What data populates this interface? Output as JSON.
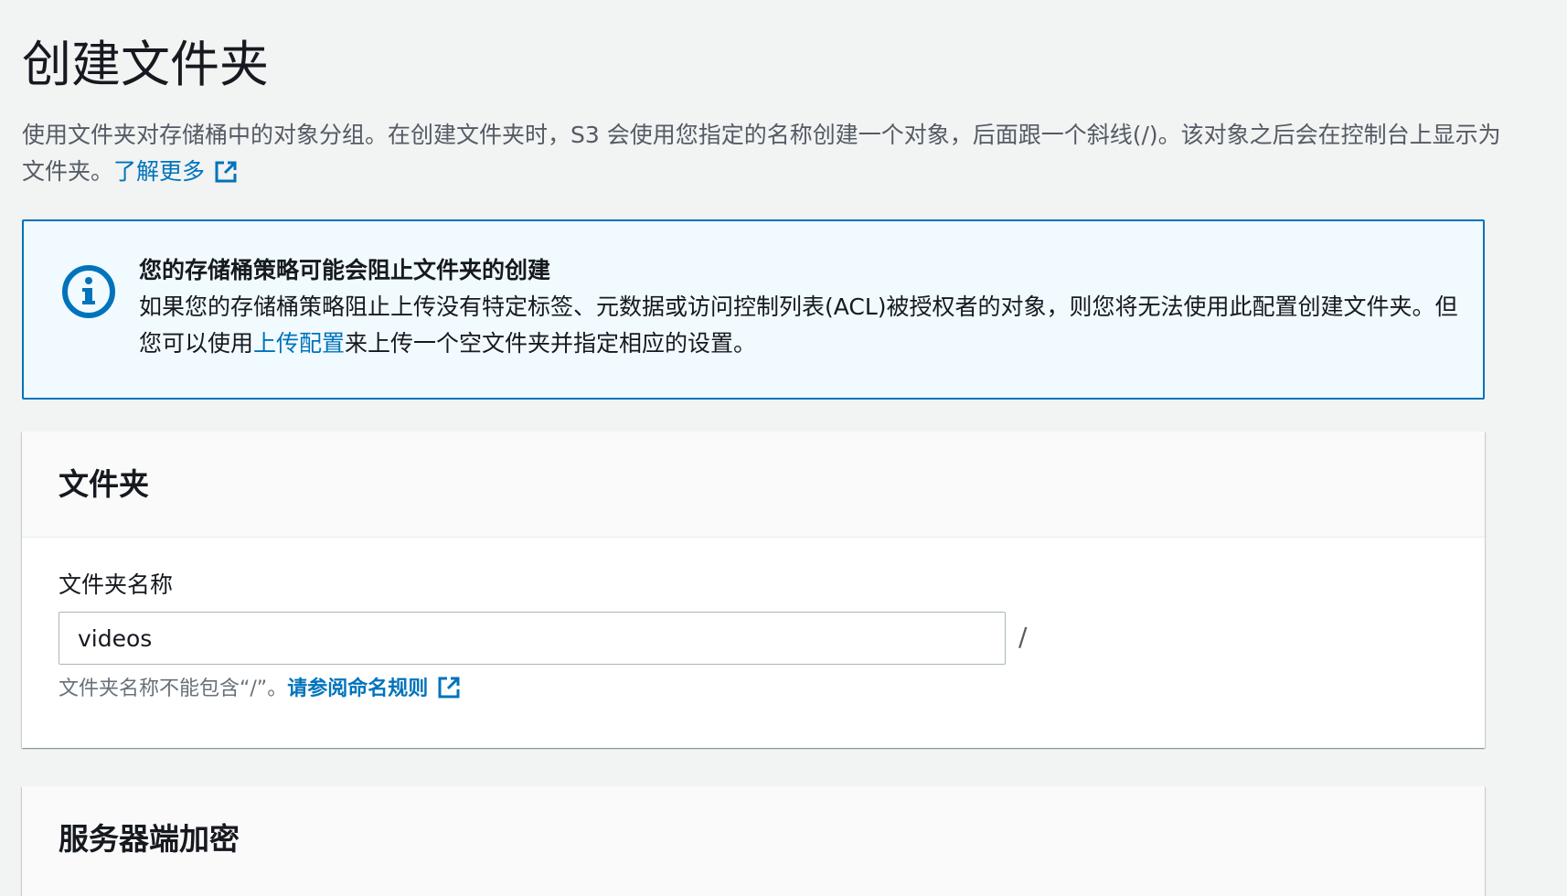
{
  "page": {
    "title": "创建文件夹",
    "description": "使用文件夹对存储桶中的对象分组。在创建文件夹时，S3 会使用您指定的名称创建一个对象，后面跟一个斜线(/)。该对象之后会在控制台上显示为文件夹。",
    "learn_more": "了解更多"
  },
  "alert": {
    "icon": "info-icon",
    "title": "您的存储桶策略可能会阻止文件夹的创建",
    "text_before": "如果您的存储桶策略阻止上传没有特定标签、元数据或访问控制列表(ACL)被授权者的对象，则您将无法使用此配置创建文件夹。但您可以使用",
    "link": "上传配置",
    "text_after": "来上传一个空文件夹并指定相应的设置。"
  },
  "folder_panel": {
    "title": "文件夹",
    "field_label": "文件夹名称",
    "input_value": "videos",
    "suffix": "/",
    "hint": "文件夹名称不能包含“/”。",
    "hint_link": "请参阅命名规则"
  },
  "encryption_panel": {
    "title": "服务器端加密"
  },
  "colors": {
    "link": "#0073bb",
    "alert_border": "#0073bb",
    "alert_bg": "#f1faff",
    "page_bg": "#f2f3f3"
  }
}
